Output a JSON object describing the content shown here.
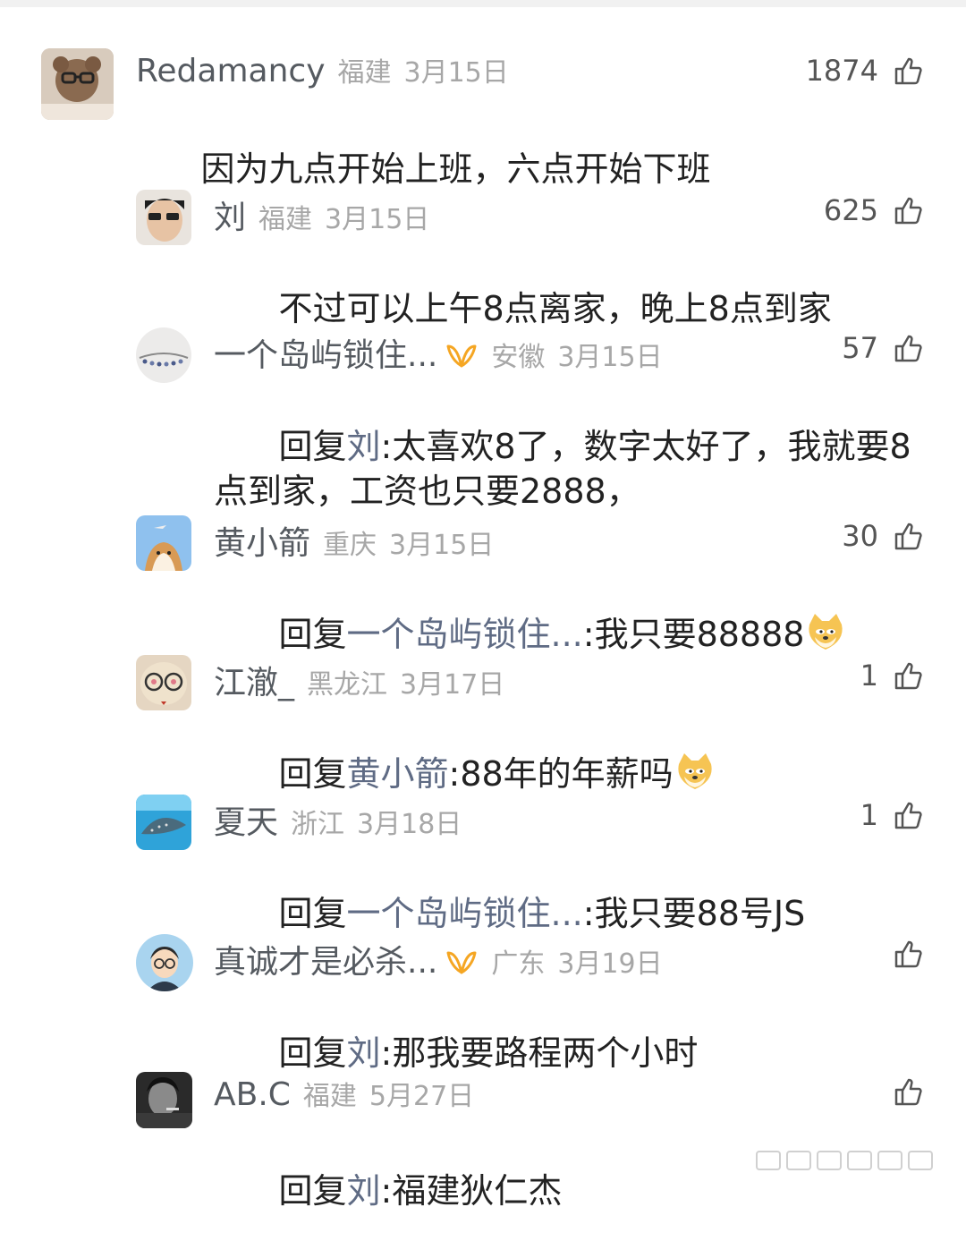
{
  "comments": [
    {
      "name": "Redamancy",
      "region": "福建",
      "date": "3月15日",
      "likes": "1874",
      "text": "因为九点开始上班，六点开始下班",
      "reply_prefix": "",
      "reply_to": "",
      "reply_colon": "",
      "emoji": "",
      "vip": false,
      "avatar": "teddy-bear-avatar"
    },
    {
      "name": "刘",
      "region": "福建",
      "date": "3月15日",
      "likes": "625",
      "text": "不过可以上午8点离家，晚上8点到家",
      "reply_prefix": "",
      "reply_to": "",
      "reply_colon": "",
      "emoji": "",
      "vip": false,
      "avatar": "man-sunglasses-avatar"
    },
    {
      "name": "一个岛屿锁住...",
      "region": "安徽",
      "date": "3月15日",
      "likes": "57",
      "text": "太喜欢8了，数字太好了，我就要8点到家，工资也只要2888，",
      "reply_prefix": "回复",
      "reply_to": "刘",
      "reply_colon": ":",
      "emoji": "",
      "vip": true,
      "avatar": "necklace-avatar"
    },
    {
      "name": "黄小箭",
      "region": "重庆",
      "date": "3月15日",
      "likes": "30",
      "text": "我只要88888",
      "reply_prefix": "回复",
      "reply_to": "一个岛屿锁住...",
      "reply_colon": ":",
      "emoji": "doge-emoji",
      "vip": false,
      "avatar": "shiba-dog-avatar"
    },
    {
      "name": "江澈_",
      "region": "黑龙江",
      "date": "3月17日",
      "likes": "1",
      "text": "88年的年薪吗",
      "reply_prefix": "回复",
      "reply_to": "黄小箭",
      "reply_colon": ":",
      "emoji": "doge-emoji",
      "vip": false,
      "avatar": "puppy-glasses-avatar"
    },
    {
      "name": "夏天",
      "region": "浙江",
      "date": "3月18日",
      "likes": "1",
      "text": "我只要88号JS",
      "reply_prefix": "回复",
      "reply_to": "一个岛屿锁住...",
      "reply_colon": ":",
      "emoji": "",
      "vip": false,
      "avatar": "whale-shark-avatar"
    },
    {
      "name": "真诚才是必杀...",
      "region": "广东",
      "date": "3月19日",
      "likes": "",
      "text": "那我要路程两个小时",
      "reply_prefix": "回复",
      "reply_to": "刘",
      "reply_colon": ":",
      "emoji": "",
      "vip": true,
      "avatar": "cartoon-boy-avatar"
    },
    {
      "name": "AB.C",
      "region": "福建",
      "date": "5月27日",
      "likes": "",
      "text": "福建狄仁杰",
      "reply_prefix": "回复",
      "reply_to": "刘",
      "reply_colon": ":",
      "emoji": "",
      "vip": false,
      "avatar": "bw-photo-avatar"
    }
  ],
  "colors": {
    "name": "#555a60",
    "meta": "#a7a7a7",
    "text": "#222222",
    "reply_target": "#5f6b84",
    "vip": "#f5a623"
  }
}
